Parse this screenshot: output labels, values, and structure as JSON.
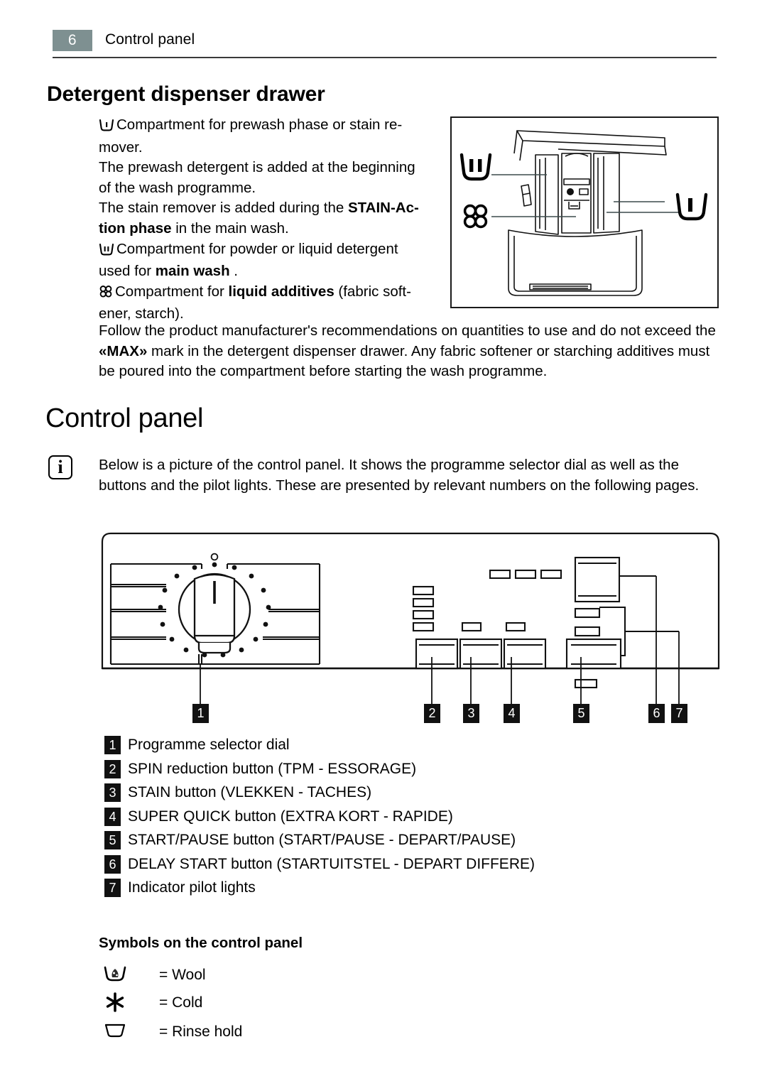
{
  "header": {
    "page_number": "6",
    "title": "Control panel"
  },
  "section_detergent": {
    "heading": "Detergent dispenser drawer",
    "lines": [
      {
        "symbol": "prewash-tub-icon",
        "text": "Compartment for prewash phase or stain re-"
      },
      {
        "symbol": null,
        "text": "mover."
      },
      {
        "symbol": null,
        "text": "The prewash detergent is added at the beginning"
      },
      {
        "symbol": null,
        "text": "of the wash programme."
      },
      {
        "symbol": null,
        "text_pre": "The stain remover is added during the ",
        "text_bold": "STAIN-Ac-"
      },
      {
        "symbol": null,
        "text_bold2": "tion phase",
        "text_post": " in the main wash."
      },
      {
        "symbol": "mainwash-tub-icon",
        "text": "Compartment for powder or liquid detergent"
      },
      {
        "symbol": null,
        "text_pre2": "used for ",
        "text_bold3": "main wash",
        "text_post2": " ."
      },
      {
        "symbol": "softener-flower-icon",
        "text_pre3": "Compartment for ",
        "text_bold4": "liquid additives",
        "text_post3": " (fabric soft-"
      },
      {
        "symbol": null,
        "text": "ener, starch)."
      }
    ],
    "follow_paragraph": {
      "part1": "Follow the product manufacturer's recommendations on quantities to use and do not exceed the ",
      "bold": "«MAX»",
      "part2": " mark in the detergent dispenser drawer. Any fabric softener or starching additives must be poured into the compartment before starting the wash programme."
    }
  },
  "section_control_panel": {
    "heading": "Control panel",
    "info_icon": "info-icon",
    "info_text": "Below is a picture of the control panel. It shows the programme selector dial as well as the buttons and the pilot lights. These are presented by relevant numbers on the following pages.",
    "callouts": [
      "1",
      "2",
      "3",
      "4",
      "5",
      "6",
      "7"
    ],
    "legend": [
      {
        "number": "1",
        "label": "Programme selector dial"
      },
      {
        "number": "2",
        "label": "SPIN reduction button (TPM - ESSORAGE)"
      },
      {
        "number": "3",
        "label": "STAIN button (VLEKKEN - TACHES)"
      },
      {
        "number": "4",
        "label": "SUPER QUICK button (EXTRA KORT - RAPIDE)"
      },
      {
        "number": "5",
        "label": "START/PAUSE button (START/PAUSE - DEPART/PAUSE)"
      },
      {
        "number": "6",
        "label": "DELAY START button (STARTUITSTEL - DEPART DIFFERE)"
      },
      {
        "number": "7",
        "label": "Indicator pilot lights"
      }
    ]
  },
  "section_symbols": {
    "heading": "Symbols on the control panel",
    "rows": [
      {
        "icon": "wool-tub-icon",
        "meaning": "= Wool"
      },
      {
        "icon": "cold-asterisk-icon",
        "meaning": "= Cold"
      },
      {
        "icon": "rinse-hold-tub-icon",
        "meaning": "= Rinse hold"
      }
    ]
  },
  "colors": {
    "page_number_box": "#7e9091",
    "rule": "#3a3a3a",
    "badge": "#111111",
    "ink": "#000000"
  }
}
